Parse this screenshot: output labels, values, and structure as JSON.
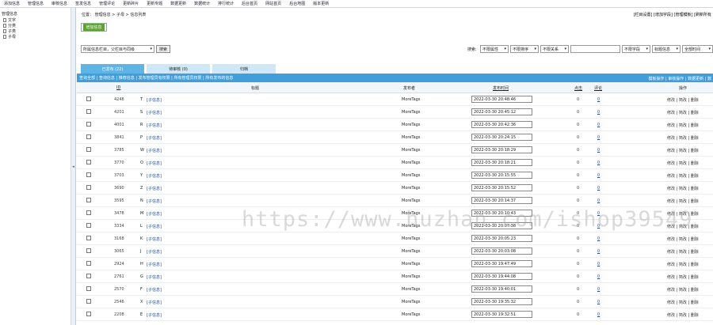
{
  "topnav": [
    "添加信息",
    "管理信息",
    "审核信息",
    "签发信息",
    "管理评论",
    "更新碎片",
    "更新专题",
    "数据更新",
    "数据统计",
    "排行统计",
    "后台首页",
    "网站首页",
    "后台地图",
    "版本更新"
  ],
  "sidebar": {
    "title": "管理信息",
    "items": [
      "文字",
      "分类",
      "子类",
      "子母"
    ]
  },
  "collapse_icon": "◂",
  "breadcrumb": "位置：  管理信息  >  子母  >  信息列表",
  "top_right_links": "[栏目设置] [增加字段] [管理模板] [刷新所有",
  "add_button": "增加信息",
  "location_select": "所属信息栏目，父栏目与同级",
  "jump_button": "搜索",
  "filter": {
    "search_label": "搜索:",
    "attr_select": "不限属性",
    "sort_select": "不限排序",
    "field_select": "不限关系",
    "field2_select": "不限字段",
    "title_select": "标题信息",
    "user_select": "全部时间"
  },
  "tabs": {
    "published": "已发布 (22)",
    "pending": "待审核 (0)",
    "draft": "归档"
  },
  "subbar": {
    "left": "查询全部 | 查询信息 | 推荐信息 | 发布管理员有权限 | 所有管理员权限 | 所有发布的信息",
    "right": "模板操作 | 审核操作 | 数据更新 | 数"
  },
  "columns": {
    "id": "ID",
    "title": "标题",
    "publisher": "发布者",
    "time": "发布时间",
    "clicks": "点击",
    "comments": "评论",
    "ops": "操作"
  },
  "rows": [
    {
      "id": "4248",
      "letter": "T",
      "tag": "[子信息]",
      "publisher": "MoreTags",
      "time": "2022-03-30 20:48:46",
      "clicks": "0",
      "comments": "0"
    },
    {
      "id": "4201",
      "letter": "S",
      "tag": "[子信息]",
      "publisher": "MoreTags",
      "time": "2022-03-30 20:45:12",
      "clicks": "0",
      "comments": "0"
    },
    {
      "id": "4001",
      "letter": "R",
      "tag": "[子信息]",
      "publisher": "MoreTags",
      "time": "2022-03-30 20:42:36",
      "clicks": "0",
      "comments": "0"
    },
    {
      "id": "3841",
      "letter": "P",
      "tag": "[子信息]",
      "publisher": "MoreTags",
      "time": "2022-03-30 20:24:15",
      "clicks": "0",
      "comments": "0"
    },
    {
      "id": "3785",
      "letter": "W",
      "tag": "[子信息]",
      "publisher": "MoreTags",
      "time": "2022-03-30 20:18:29",
      "clicks": "0",
      "comments": "0"
    },
    {
      "id": "3770",
      "letter": "O",
      "tag": "[子信息]",
      "publisher": "MoreTags",
      "time": "2022-03-30 20:18:21",
      "clicks": "0",
      "comments": "0"
    },
    {
      "id": "3703",
      "letter": "Y",
      "tag": "[子信息]",
      "publisher": "MoreTags",
      "time": "2022-03-30 20:15:55",
      "clicks": "0",
      "comments": "0"
    },
    {
      "id": "3690",
      "letter": "Z",
      "tag": "[子信息]",
      "publisher": "MoreTags",
      "time": "2022-03-30 20:15:52",
      "clicks": "0",
      "comments": "0"
    },
    {
      "id": "3595",
      "letter": "N",
      "tag": "[子信息]",
      "publisher": "MoreTags",
      "time": "2022-03-30 20:14:37",
      "clicks": "0",
      "comments": "0"
    },
    {
      "id": "3478",
      "letter": "M",
      "tag": "[子信息]",
      "publisher": "MoreTags",
      "time": "2022-03-30 20:10:43",
      "clicks": "0",
      "comments": "0"
    },
    {
      "id": "3334",
      "letter": "L",
      "tag": "[子信息]",
      "publisher": "MoreTags",
      "time": "2022-03-30 20:07:38",
      "clicks": "0",
      "comments": "0"
    },
    {
      "id": "3168",
      "letter": "K",
      "tag": "[子信息]",
      "publisher": "MoreTags",
      "time": "2022-03-30 20:05:23",
      "clicks": "0",
      "comments": "0"
    },
    {
      "id": "3065",
      "letter": "J",
      "tag": "[子信息]",
      "publisher": "MoreTags",
      "time": "2022-03-30 20:03:08",
      "clicks": "0",
      "comments": "0"
    },
    {
      "id": "2924",
      "letter": "H",
      "tag": "[子信息]",
      "publisher": "MoreTags",
      "time": "2022-03-30 19:47:49",
      "clicks": "0",
      "comments": "0"
    },
    {
      "id": "2761",
      "letter": "G",
      "tag": "[子信息]",
      "publisher": "MoreTags",
      "time": "2022-03-30 19:44:08",
      "clicks": "0",
      "comments": "0"
    },
    {
      "id": "2570",
      "letter": "F",
      "tag": "[子信息]",
      "publisher": "MoreTags",
      "time": "2022-03-30 19:40:01",
      "clicks": "0",
      "comments": "0"
    },
    {
      "id": "2546",
      "letter": "X",
      "tag": "[子信息]",
      "publisher": "MoreTags",
      "time": "2022-03-30 19:35:32",
      "clicks": "0",
      "comments": "0"
    },
    {
      "id": "2208",
      "letter": "E",
      "tag": "[子信息]",
      "publisher": "MoreTags",
      "time": "2022-03-30 19:32:51",
      "clicks": "0",
      "comments": "0"
    }
  ],
  "row_ops": {
    "edit": "修改",
    "simple": "简改",
    "del": "删除"
  },
  "watermark": "https://www.huzhan.com/ishop39549",
  "colors": {
    "accent": "#3f9fdc",
    "tab_active": "#5fb4e6",
    "tab_inactive": "#cfe8f7",
    "add_green": "#5aa52f"
  }
}
